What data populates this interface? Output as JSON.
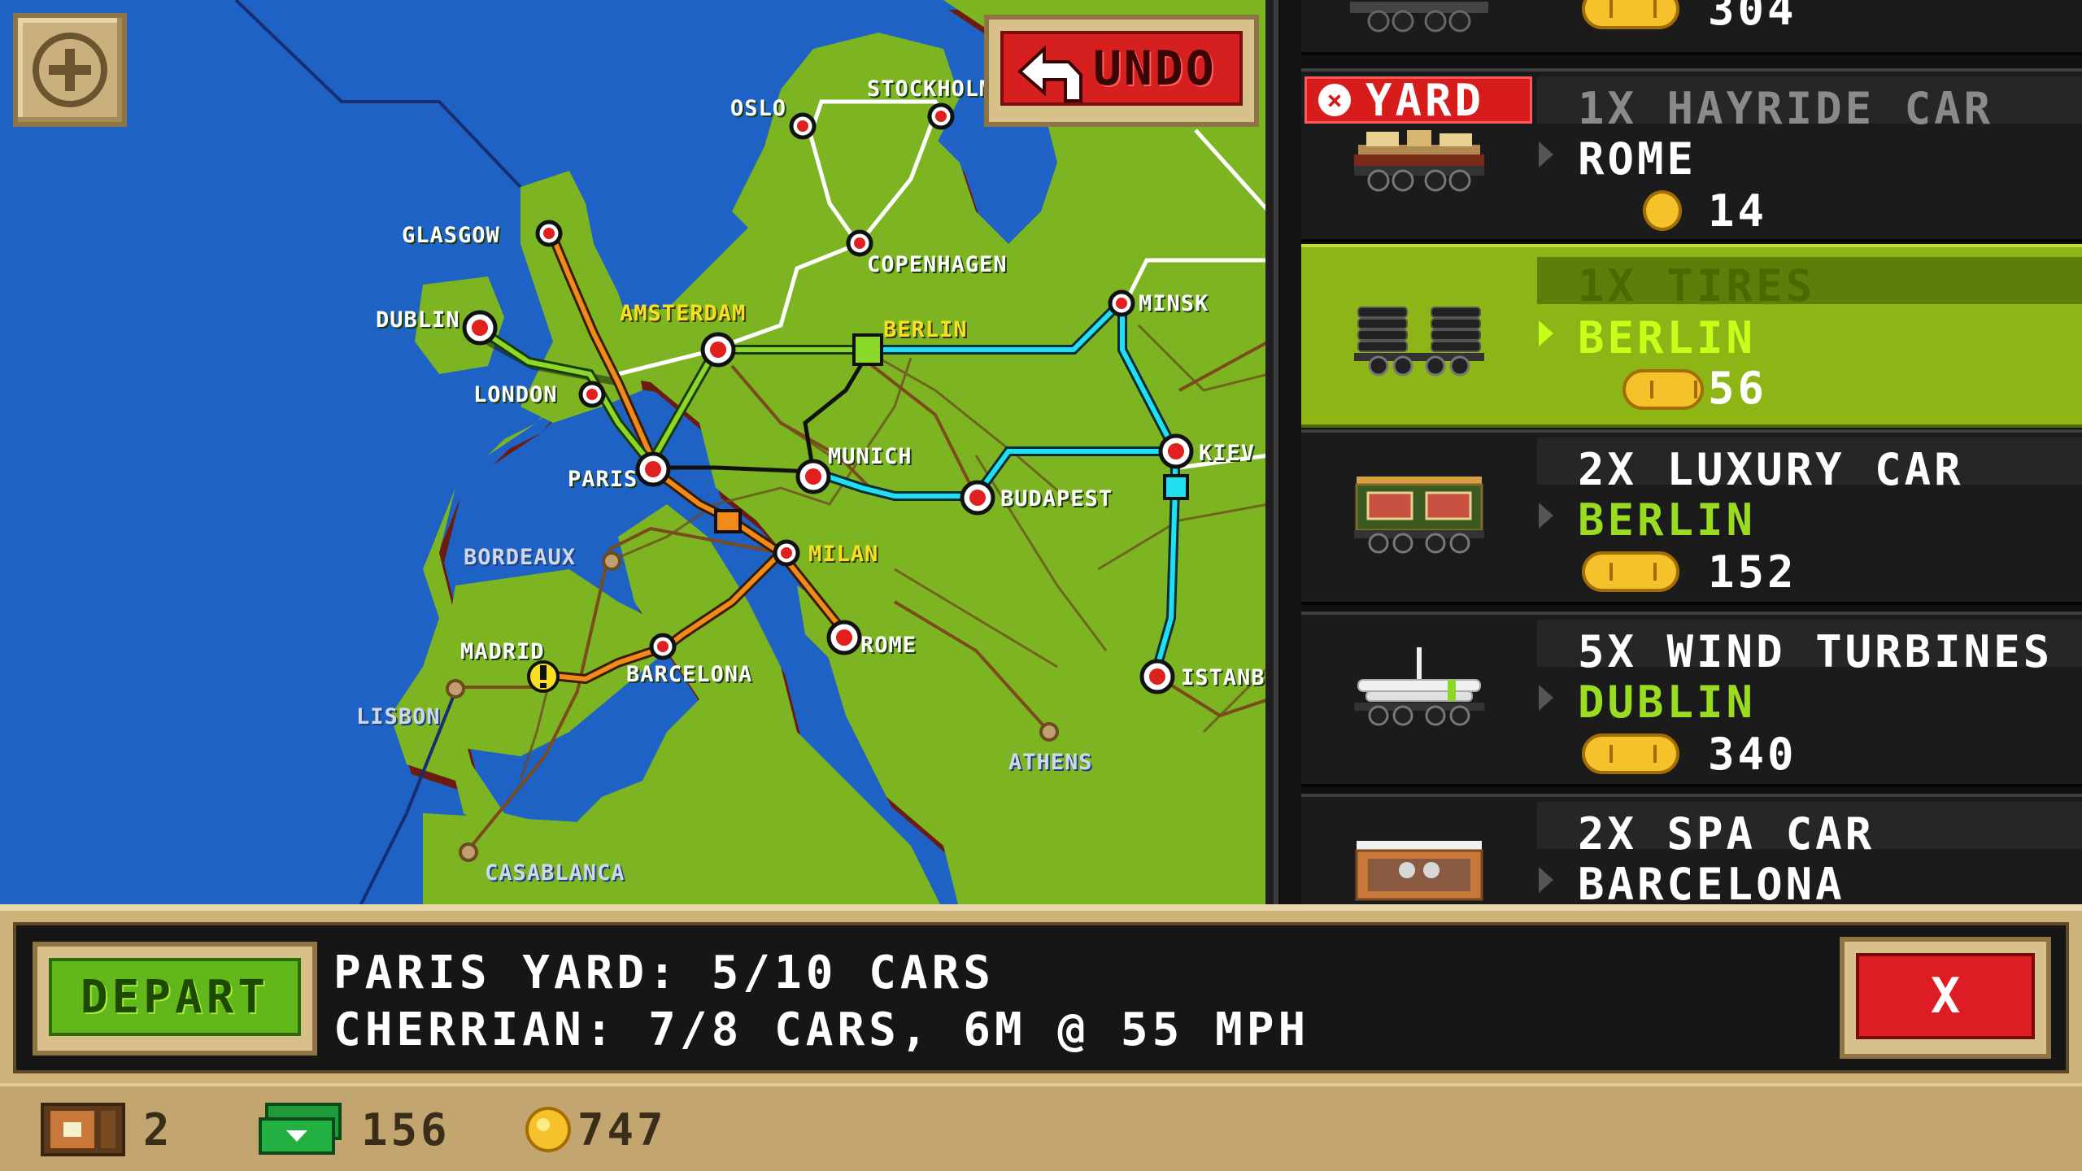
{
  "map": {
    "zoom_button_icon": "zoom-in-icon",
    "undo_label": "UNDO",
    "cities": [
      {
        "name": "OSLO",
        "style": "white"
      },
      {
        "name": "STOCKHOLM",
        "style": "white"
      },
      {
        "name": "GLASGOW",
        "style": "white"
      },
      {
        "name": "COPENHAGEN",
        "style": "white"
      },
      {
        "name": "DUBLIN",
        "style": "white"
      },
      {
        "name": "AMSTERDAM",
        "style": "yellow"
      },
      {
        "name": "BERLIN",
        "style": "yellow"
      },
      {
        "name": "MINSK",
        "style": "white"
      },
      {
        "name": "LONDON",
        "style": "white"
      },
      {
        "name": "MUNICH",
        "style": "white"
      },
      {
        "name": "KIEV",
        "style": "white"
      },
      {
        "name": "PARIS",
        "style": "white"
      },
      {
        "name": "BUDAPEST",
        "style": "white"
      },
      {
        "name": "BORDEAUX",
        "style": "water"
      },
      {
        "name": "MILAN",
        "style": "yellow"
      },
      {
        "name": "ROME",
        "style": "white"
      },
      {
        "name": "MADRID",
        "style": "white"
      },
      {
        "name": "BARCELONA",
        "style": "white"
      },
      {
        "name": "ISTANBUL",
        "style": "white"
      },
      {
        "name": "LISBON",
        "style": "water"
      },
      {
        "name": "ATHENS",
        "style": "water"
      },
      {
        "name": "CASABLANCA",
        "style": "water"
      }
    ]
  },
  "cargo_list": {
    "top_partial_price": "304",
    "items": [
      {
        "title": "1X HAYRIDE CAR",
        "destination": "ROME",
        "price": "14",
        "badge": "YARD",
        "selected": false
      },
      {
        "title": "1X TIRES",
        "destination": "BERLIN",
        "price": "56",
        "badge": "",
        "selected": true
      },
      {
        "title": "2X LUXURY CAR",
        "destination": "BERLIN",
        "price": "152",
        "badge": "",
        "selected": false
      },
      {
        "title": "5X WIND TURBINES",
        "destination": "DUBLIN",
        "price": "340",
        "badge": "",
        "selected": false
      },
      {
        "title": "2X SPA CAR",
        "destination": "BARCELONA",
        "price": "",
        "badge": "",
        "selected": false
      }
    ]
  },
  "info_bar": {
    "depart_label": "DEPART",
    "line1": "PARIS YARD: 5/10 CARS",
    "line2": "CHERRIAN: 7/8 CARS, 6M @ 55 MPH",
    "close_label": "X"
  },
  "resources": {
    "trains": "2",
    "cash": "156",
    "coins": "747"
  },
  "colors": {
    "sea": "#1d62c4",
    "land": "#7cb521",
    "selected_card": "#8cb515",
    "route_cyan": "#1fe0f0",
    "route_orange": "#f08a1a",
    "route_green": "#8ad82a"
  }
}
